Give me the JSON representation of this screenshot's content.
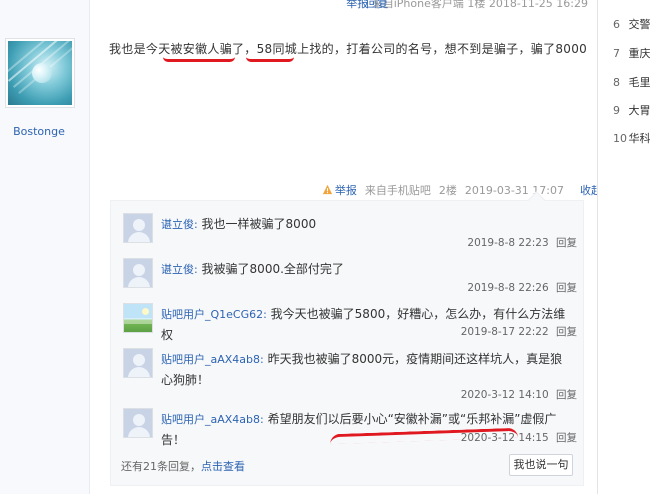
{
  "top_meta": {
    "report": "举报",
    "source": "来自iPhone客户端",
    "floor": "1楼",
    "time": "2018-11-25 16:29",
    "reply": "回复"
  },
  "post": {
    "username": "Bostonge",
    "text": "我也是今天被安徽人骗了，58同城上找的，打着公司的名号，想不到是骗子，骗了8000",
    "meta": {
      "report": "举报",
      "source": "来自手机贴吧",
      "floor": "2楼",
      "time": "2019-03-31 17:07",
      "collapse": "收起回复"
    }
  },
  "replies": [
    {
      "name": "谌立俊:",
      "text": "我也一样被骗了8000",
      "time": "2019-8-8 22:23",
      "reply": "回复",
      "avatar": "default"
    },
    {
      "name": "谌立俊:",
      "text": "我被骗了8000.全部付完了",
      "time": "2019-8-8 22:26",
      "reply": "回复",
      "avatar": "default"
    },
    {
      "name": "贴吧用户_Q1eCG62:",
      "text": "我今天也被骗了5800，好糟心，怎么办，有什么方法维权",
      "time": "2019-8-17 22:22",
      "reply": "回复",
      "avatar": "landscape"
    },
    {
      "name": "贴吧用户_aAX4ab8:",
      "text": "昨天我也被骗了8000元，疫情期间还这样坑人，真是狼心狗肺！",
      "time": "2020-3-12 14:10",
      "reply": "回复",
      "avatar": "default"
    },
    {
      "name": "贴吧用户_aAX4ab8:",
      "text": "希望朋友们以后要小心“安徽补漏”或“乐邦补漏”虚假广告！",
      "time": "2020-3-12 14:15",
      "reply": "回复",
      "avatar": "default"
    }
  ],
  "footer": {
    "more_prefix": "还有21条回复，",
    "more_link": "点击查看",
    "say_button": "我也说一句"
  },
  "ranking": [
    {
      "num": "6",
      "label": "交警"
    },
    {
      "num": "7",
      "label": "重庆"
    },
    {
      "num": "8",
      "label": "毛里"
    },
    {
      "num": "9",
      "label": "大胃"
    },
    {
      "num": "10",
      "label": "华科"
    }
  ],
  "colors": {
    "link": "#2d64b3",
    "annotation_red": "#e0181f"
  }
}
